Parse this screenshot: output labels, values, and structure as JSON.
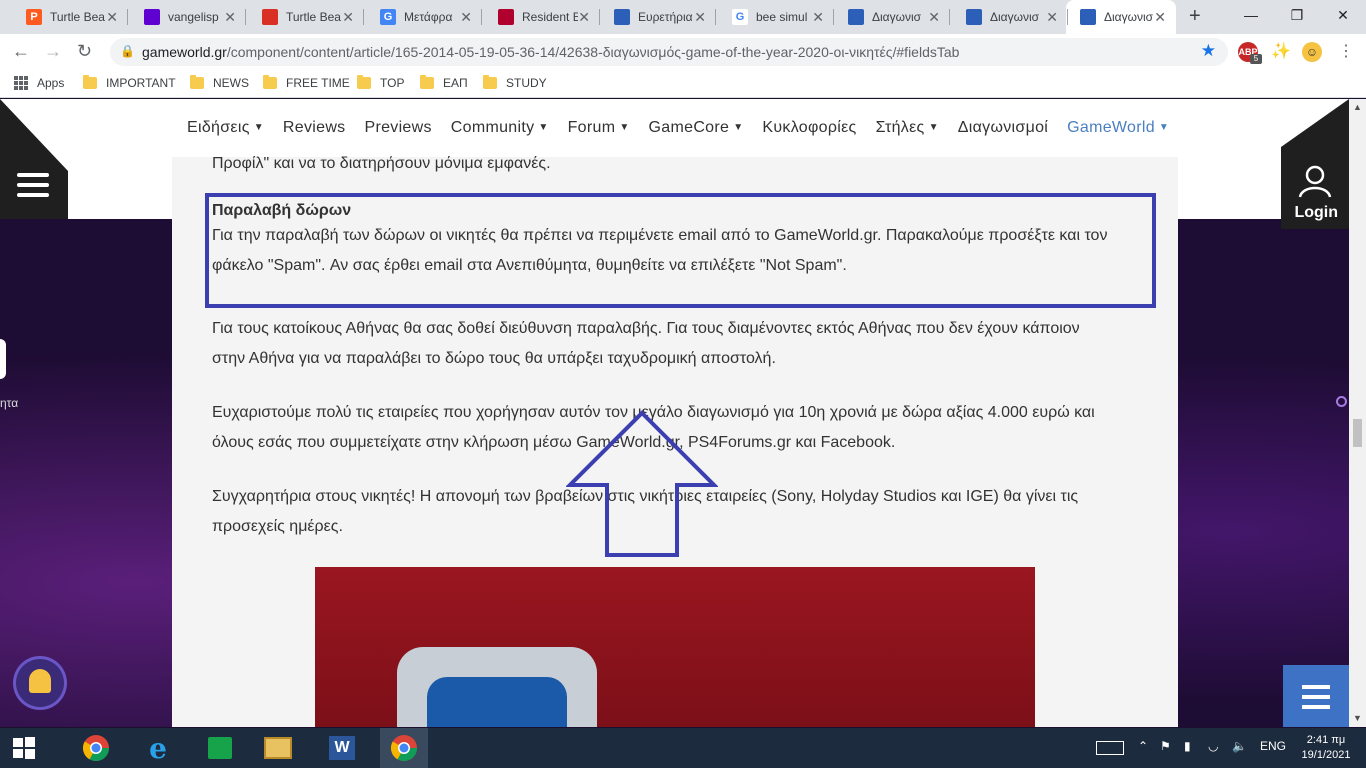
{
  "browser": {
    "tabs": [
      {
        "title": "Turtle Bea",
        "icon": "p-icon",
        "icon_color": "#ff5a1f",
        "glyph": "P"
      },
      {
        "title": "vangelisp",
        "icon": "mail-icon",
        "icon_color": "#5f01d1",
        "glyph": ""
      },
      {
        "title": "Turtle Bea",
        "icon": "gear-logo-icon",
        "icon_color": "#d93025",
        "glyph": ""
      },
      {
        "title": "Μετάφρα",
        "icon": "translate-icon",
        "icon_color": "#4285f4",
        "glyph": "G"
      },
      {
        "title": "Resident E",
        "icon": "resident-icon",
        "icon_color": "#b0002e",
        "glyph": ""
      },
      {
        "title": "Ευρετήρια",
        "icon": "site-icon",
        "icon_color": "#2c5fb8",
        "glyph": ""
      },
      {
        "title": "bee simul",
        "icon": "google-icon",
        "icon_color": "#ffffff",
        "glyph": "G"
      },
      {
        "title": "Διαγωνισ",
        "icon": "site-icon",
        "icon_color": "#2c5fb8",
        "glyph": ""
      },
      {
        "title": "Διαγωνισ",
        "icon": "site-icon",
        "icon_color": "#2c5fb8",
        "glyph": ""
      },
      {
        "title": "Διαγωνισ",
        "icon": "site-icon",
        "icon_color": "#2c5fb8",
        "glyph": "",
        "active": true
      }
    ],
    "new_tab": "+",
    "window_controls": {
      "minimize": "—",
      "maximize": "❐",
      "close": "✕"
    },
    "url_host": "gameworld.gr",
    "url_path": "/component/content/article/165-2014-05-19-05-36-14/42638-διαγωνισμός-game-of-the-year-2020-οι-νικητές/#fieldsTab",
    "ext_badge": "5",
    "ext_label": "ABP",
    "bookmarks": [
      "Apps",
      "IMPORTANT",
      "NEWS",
      "FREE TIME",
      "TOP",
      "ΕΑΠ",
      "STUDY"
    ]
  },
  "site": {
    "nav": [
      {
        "label": "Ειδήσεις",
        "dropdown": true
      },
      {
        "label": "Reviews",
        "dropdown": false
      },
      {
        "label": "Previews",
        "dropdown": false
      },
      {
        "label": "Community",
        "dropdown": true
      },
      {
        "label": "Forum",
        "dropdown": true
      },
      {
        "label": "GameCore",
        "dropdown": true
      },
      {
        "label": "Κυκλοφορίες",
        "dropdown": false
      },
      {
        "label": "Στήλες",
        "dropdown": true
      },
      {
        "label": "Διαγωνισμοί",
        "dropdown": false
      },
      {
        "label": "GameWorld",
        "dropdown": true,
        "accent": true
      }
    ],
    "login_label": "Login",
    "side_text": "ητα",
    "accent_color": "#4a7fc1",
    "highlight_color": "#3b3fb0"
  },
  "article": {
    "p0": "Προφίλ\" και να το διατηρήσουν μόνιμα εμφανές.",
    "gifts_heading": "Παραλαβή δώρων",
    "gifts_line1": "Για την παραλαβή των δώρων οι νικητές θα πρέπει να περιμένετε email από το GameWorld.gr. Παρακαλούμε προσέξτε και τον",
    "gifts_line2": "φάκελο \"Spam\". Αν σας έρθει email στα Ανεπιθύμητα, θυμηθείτε να επιλέξετε \"Not Spam\".",
    "p2_line1": "Για τους κατοίκους Αθήνας θα σας δοθεί διεύθυνση παραλαβής. Για τους διαμένοντες εκτός Αθήνας που δεν έχουν κάποιον",
    "p2_line2": "στην Αθήνα για να παραλάβει το δώρο τους θα υπάρξει ταχυδρομική αποστολή.",
    "p3_line1": "Ευχαριστούμε πολύ τις εταιρείες που χορήγησαν αυτόν τον μεγάλο διαγωνισμό για 10η χρονιά με δώρα αξίας 4.000 ευρώ και",
    "p3_line2": "όλους εσάς που συμμετείχατε στην κλήρωση μέσω GameWorld.gr, PS4Forums.gr και Facebook.",
    "p4_line1": "Συγχαρητήρια στους νικητές! Η απονομή των βραβείων στις νικήτριες εταιρείες (Sony, Holyday Studios και IGE) θα γίνει τις",
    "p4_line2": "προσεχείς ημέρες."
  },
  "taskbar": {
    "apps": [
      "start-icon",
      "chrome-icon",
      "ie-icon",
      "store-icon",
      "explorer-icon",
      "word-icon",
      "chrome-active-icon"
    ],
    "language": "ENG",
    "time": "2:41 πμ",
    "date": "19/1/2021"
  }
}
